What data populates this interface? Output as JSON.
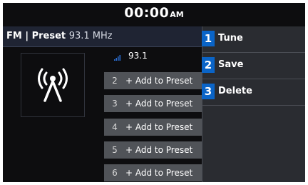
{
  "clock": {
    "time": "00:00",
    "ampm": "AM"
  },
  "header": {
    "title": "FM | Preset",
    "frequency": "93.1 MHz"
  },
  "art": {
    "icon": "radio-antenna-icon"
  },
  "current_station": {
    "frequency": "93.1",
    "signal_icon": "signal-strength-icon"
  },
  "presets": [
    {
      "number": "2",
      "label": "+ Add to Preset"
    },
    {
      "number": "3",
      "label": "+ Add to Preset"
    },
    {
      "number": "4",
      "label": "+ Add to Preset"
    },
    {
      "number": "5",
      "label": "+ Add to Preset"
    },
    {
      "number": "6",
      "label": "+ Add to Preset"
    }
  ],
  "menu": {
    "items": [
      {
        "number": "1",
        "label": "Tune"
      },
      {
        "number": "2",
        "label": "Save"
      },
      {
        "number": "3",
        "label": "Delete"
      }
    ]
  },
  "colors": {
    "badge": "#0a64c7",
    "panel": "#0d0d0f",
    "preset_bg": "#505358",
    "menu_bg": "#2a2c31"
  }
}
